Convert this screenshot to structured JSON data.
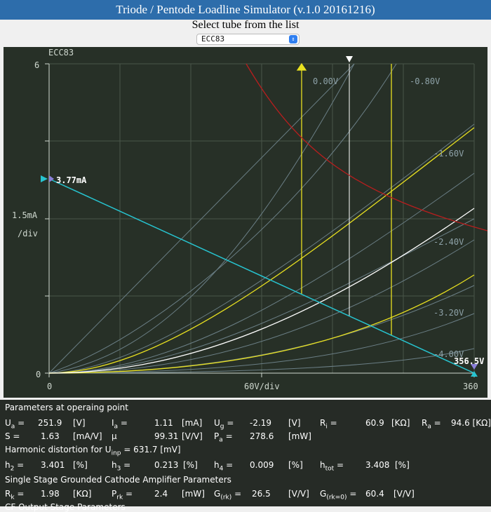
{
  "header": {
    "title": "Triode / Pentode Loadline Simulator (v.1.0 20161216)",
    "select_label": "Select tube from the list",
    "selected_tube": "ECC83"
  },
  "plot": {
    "tube_label": "ECC83",
    "y_top_label": "6",
    "y_mid_label": "1.5mA",
    "y_div_label": "/div",
    "y_zero_label": "0",
    "x_zero_label": "0",
    "x_div_label": "60V/div",
    "x_max_label": "360",
    "current_marker": "3.77mA",
    "voltage_marker": "356.5V",
    "grid_labels": [
      "0.00V",
      "-0.80V",
      "-1.60V",
      "-2.40V",
      "-3.20V",
      "-4.00V"
    ],
    "colors": {
      "background": "#273027",
      "loadline": "#27c4d0",
      "power": "#b81e1e",
      "yellow": "#e8e020",
      "white": "#ffffff",
      "grid": "#6b7f86"
    }
  },
  "chart_data": {
    "type": "line",
    "title": "ECC83",
    "xlabel": "60V/div",
    "ylabel": "1.5mA /div",
    "xlim": [
      0,
      360
    ],
    "ylim": [
      0,
      6
    ],
    "loadline": {
      "x": [
        0,
        356.5
      ],
      "y": [
        3.77,
        0
      ]
    },
    "operating_point": {
      "ua": 251.9,
      "ia": 1.11
    },
    "curves": [
      {
        "ug": "0.00V",
        "color": "gray"
      },
      {
        "ug": "-0.80V",
        "color": "gray"
      },
      {
        "ug": "-1.60V",
        "color": "gray"
      },
      {
        "ug": "-2.19V",
        "color": "white"
      },
      {
        "ug": "-2.40V",
        "color": "gray"
      },
      {
        "ug": "-3.20V",
        "color": "gray"
      },
      {
        "ug": "-4.00V",
        "color": "gray"
      }
    ]
  },
  "params": {
    "section1": "Parameters at operaing point",
    "row1": [
      {
        "sym": "U",
        "sub": "a",
        "eq": " =",
        "val": "251.9",
        "unit": "[V]"
      },
      {
        "sym": "I",
        "sub": "a",
        "eq": " =",
        "val": "1.11",
        "unit": "[mA]"
      },
      {
        "sym": "U",
        "sub": "g",
        "eq": " =",
        "val": "-2.19",
        "unit": "[V]"
      },
      {
        "sym": "R",
        "sub": "i",
        "eq": " =",
        "val": "60.9",
        "unit": "[KΩ]"
      },
      {
        "sym": "R",
        "sub": "a",
        "eq": " =",
        "val": "94.6",
        "unit": "[KΩ]"
      }
    ],
    "row2": [
      {
        "sym": "S",
        "sub": "",
        "eq": " =",
        "val": "1.63",
        "unit": "[mA/V]"
      },
      {
        "sym": "μ",
        "sub": "",
        "eq": "",
        "val": "99.31",
        "unit": "[V/V]"
      },
      {
        "sym": "P",
        "sub": "a",
        "eq": " =",
        "val": "278.6",
        "unit": "[mW]"
      }
    ],
    "section2_prefix": "Harmonic distortion for U",
    "section2_sub": "inp",
    "section2_suffix": " = 631.7 [mV]",
    "row3": [
      {
        "sym": "h",
        "sub": "2",
        "eq": " =",
        "val": "3.401",
        "unit": "[%]"
      },
      {
        "sym": "h",
        "sub": "3",
        "eq": " =",
        "val": "0.213",
        "unit": "[%]"
      },
      {
        "sym": "h",
        "sub": "4",
        "eq": " =",
        "val": "0.009",
        "unit": "[%]"
      },
      {
        "sym": "h",
        "sub": "tot",
        "eq": " =",
        "val": "3.408",
        "unit": "[%]"
      }
    ],
    "section3": "Single Stage Grounded Cathode Amplifier Parameters",
    "row4": [
      {
        "sym": "R",
        "sub": "k",
        "eq": " =",
        "val": "1.98",
        "unit": "[KΩ]"
      },
      {
        "sym": "P",
        "sub": "rk",
        "eq": " =",
        "val": "2.4",
        "unit": "[mW]"
      },
      {
        "sym": "G",
        "sub": "(rk)",
        "eq": " =",
        "val": "26.5",
        "unit": "[V/V]"
      },
      {
        "sym": "G",
        "sub": "(rk=0)",
        "eq": " =",
        "val": "60.4",
        "unit": "[V/V]"
      }
    ],
    "section4": "CF Output Stage Parameters"
  }
}
